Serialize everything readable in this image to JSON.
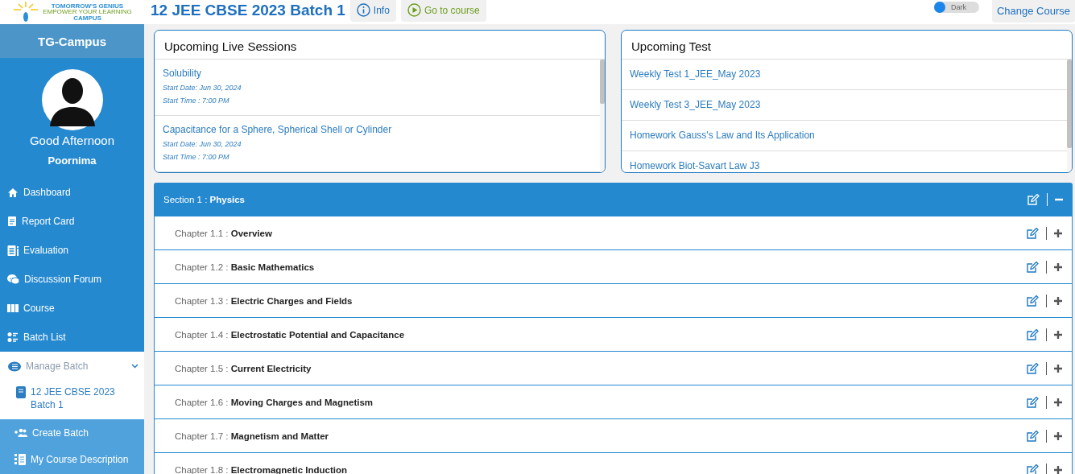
{
  "logo": {
    "title": "TOMORROW'S GENIUS",
    "tagline": "EMPOWER YOUR LEARNING",
    "subtitle": "CAMPUS"
  },
  "header": {
    "title": "12 JEE CBSE 2023 Batch 1",
    "buttons": [
      {
        "kind": "info",
        "label": "Info"
      },
      {
        "kind": "play",
        "label": "Go to course"
      }
    ],
    "dark_mode": {
      "label": "Dark",
      "on": false
    },
    "change_course": "Change Course"
  },
  "sidebar": {
    "brand": "TG-Campus",
    "greeting": "Good Afternoon",
    "user": "Poornima",
    "items": [
      {
        "kind": "home",
        "label": "Dashboard"
      },
      {
        "kind": "report",
        "label": "Report Card"
      },
      {
        "kind": "evaluation",
        "label": "Evaluation"
      },
      {
        "kind": "forum",
        "label": "Discussion Forum"
      },
      {
        "kind": "course",
        "label": "Course"
      },
      {
        "kind": "list",
        "label": "Batch List"
      }
    ],
    "manage": {
      "label": "Manage Batch",
      "expanded": true,
      "children": [
        {
          "label": "12 JEE CBSE 2023 Batch 1",
          "selected": true
        }
      ]
    },
    "actions": [
      {
        "kind": "add-people",
        "label": "Create Batch"
      },
      {
        "kind": "description",
        "label": "My Course Description"
      }
    ]
  },
  "live_sessions": {
    "title": "Upcoming Live Sessions",
    "items": [
      {
        "title": "Solubility",
        "date": "Start Date: Jun 30, 2024",
        "time": "Start Time : 7:00 PM"
      },
      {
        "title": "Capacitance for a Sphere, Spherical Shell or Cylinder",
        "date": "Start Date: Jun 30, 2024",
        "time": "Start Time : 7:00 PM"
      }
    ]
  },
  "tests": {
    "title": "Upcoming Test",
    "items": [
      "Weekly Test 1_JEE_May 2023",
      "Weekly Test 3_JEE_May 2023",
      "Homework Gauss's Law and Its Application",
      "Homework Biot-Savart Law J3"
    ]
  },
  "sections": [
    {
      "label": "Section 1 : **Physics**",
      "expanded": true,
      "children": [
        {
          "label": "Chapter  1.1 : **Overview**",
          "expanded": false
        },
        {
          "label": "Chapter  1.2 : **Basic Mathematics**",
          "expanded": false
        },
        {
          "label": "Chapter  1.3 : **Electric Charges and Fields**",
          "expanded": false
        },
        {
          "label": "Chapter  1.4 : **Electrostatic Potential and Capacitance**",
          "expanded": false
        },
        {
          "label": "Chapter  1.5 : **Current Electricity**",
          "expanded": false
        },
        {
          "label": "Chapter  1.6 : **Moving Charges and Magnetism**",
          "expanded": false
        },
        {
          "label": "Chapter  1.7 : **Magnetism and Matter**",
          "expanded": false
        },
        {
          "label": "Chapter  1.8 : **Electromagnetic Induction**",
          "expanded": false
        }
      ]
    }
  ]
}
